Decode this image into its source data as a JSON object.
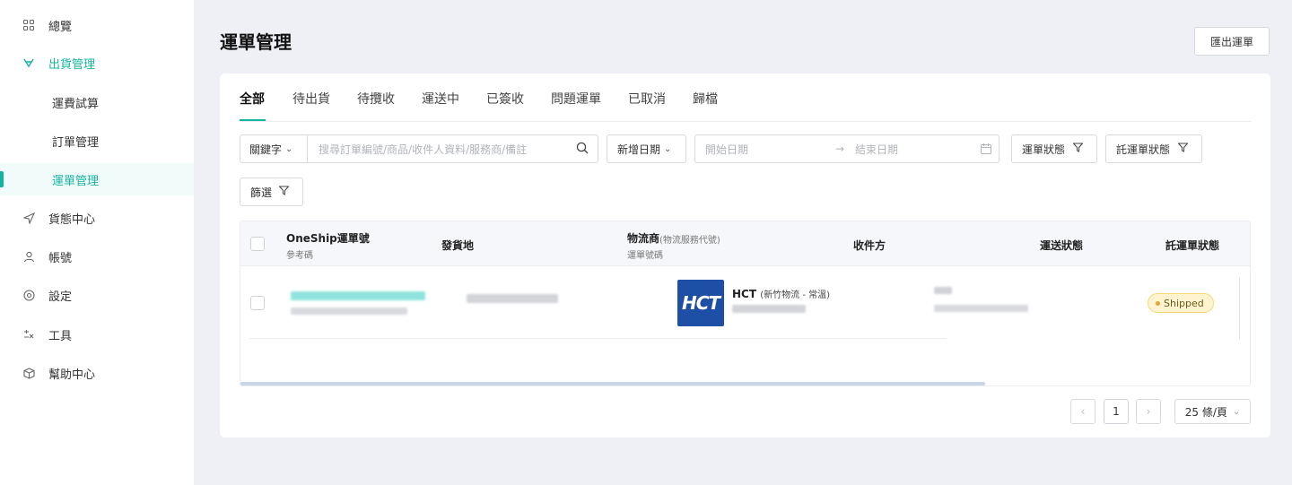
{
  "sidebar": {
    "items": [
      {
        "label": "總覽",
        "icon": "grid-icon"
      },
      {
        "label": "出貨管理",
        "icon": "shipping-icon"
      },
      {
        "label": "運費試算"
      },
      {
        "label": "訂單管理"
      },
      {
        "label": "運單管理"
      },
      {
        "label": "貨態中心",
        "icon": "send-icon"
      },
      {
        "label": "帳號",
        "icon": "user-icon"
      },
      {
        "label": "設定",
        "icon": "settings-icon"
      },
      {
        "label": "工具",
        "icon": "tools-icon"
      },
      {
        "label": "幫助中心",
        "icon": "box-icon"
      }
    ]
  },
  "header": {
    "title": "運單管理",
    "export_label": "匯出運單"
  },
  "tabs": [
    "全部",
    "待出貨",
    "待攬收",
    "運送中",
    "已簽收",
    "問題運單",
    "已取消",
    "歸檔"
  ],
  "filters": {
    "keyword_label": "關鍵字",
    "search_placeholder": "搜尋訂單編號/商品/收件人資料/服務商/備註",
    "date_type_label": "新增日期",
    "start_placeholder": "開始日期",
    "end_placeholder": "結束日期",
    "status_label": "運單狀態",
    "consign_status_label": "託運單狀態",
    "filter_label": "篩選"
  },
  "table": {
    "columns": {
      "oneship": "OneShip運單號",
      "oneship_sub": "參考碼",
      "origin": "發貨地",
      "carrier": "物流商",
      "carrier_paren": "(物流服務代號)",
      "carrier_sub": "運單號碼",
      "recipient": "收件方",
      "delivery_status": "運送狀態",
      "consign_status": "託運單狀態"
    },
    "rows": [
      {
        "carrier_logo": "HCT",
        "carrier_name": "HCT",
        "carrier_service": "(新竹物流 - 常溫)",
        "consign_status": "Shipped"
      }
    ]
  },
  "pagination": {
    "current": "1",
    "page_size": "25 條/頁"
  },
  "colors": {
    "accent": "#17b3a1",
    "hct_blue": "#1d4fa6",
    "badge_bg": "#fff4cf"
  }
}
